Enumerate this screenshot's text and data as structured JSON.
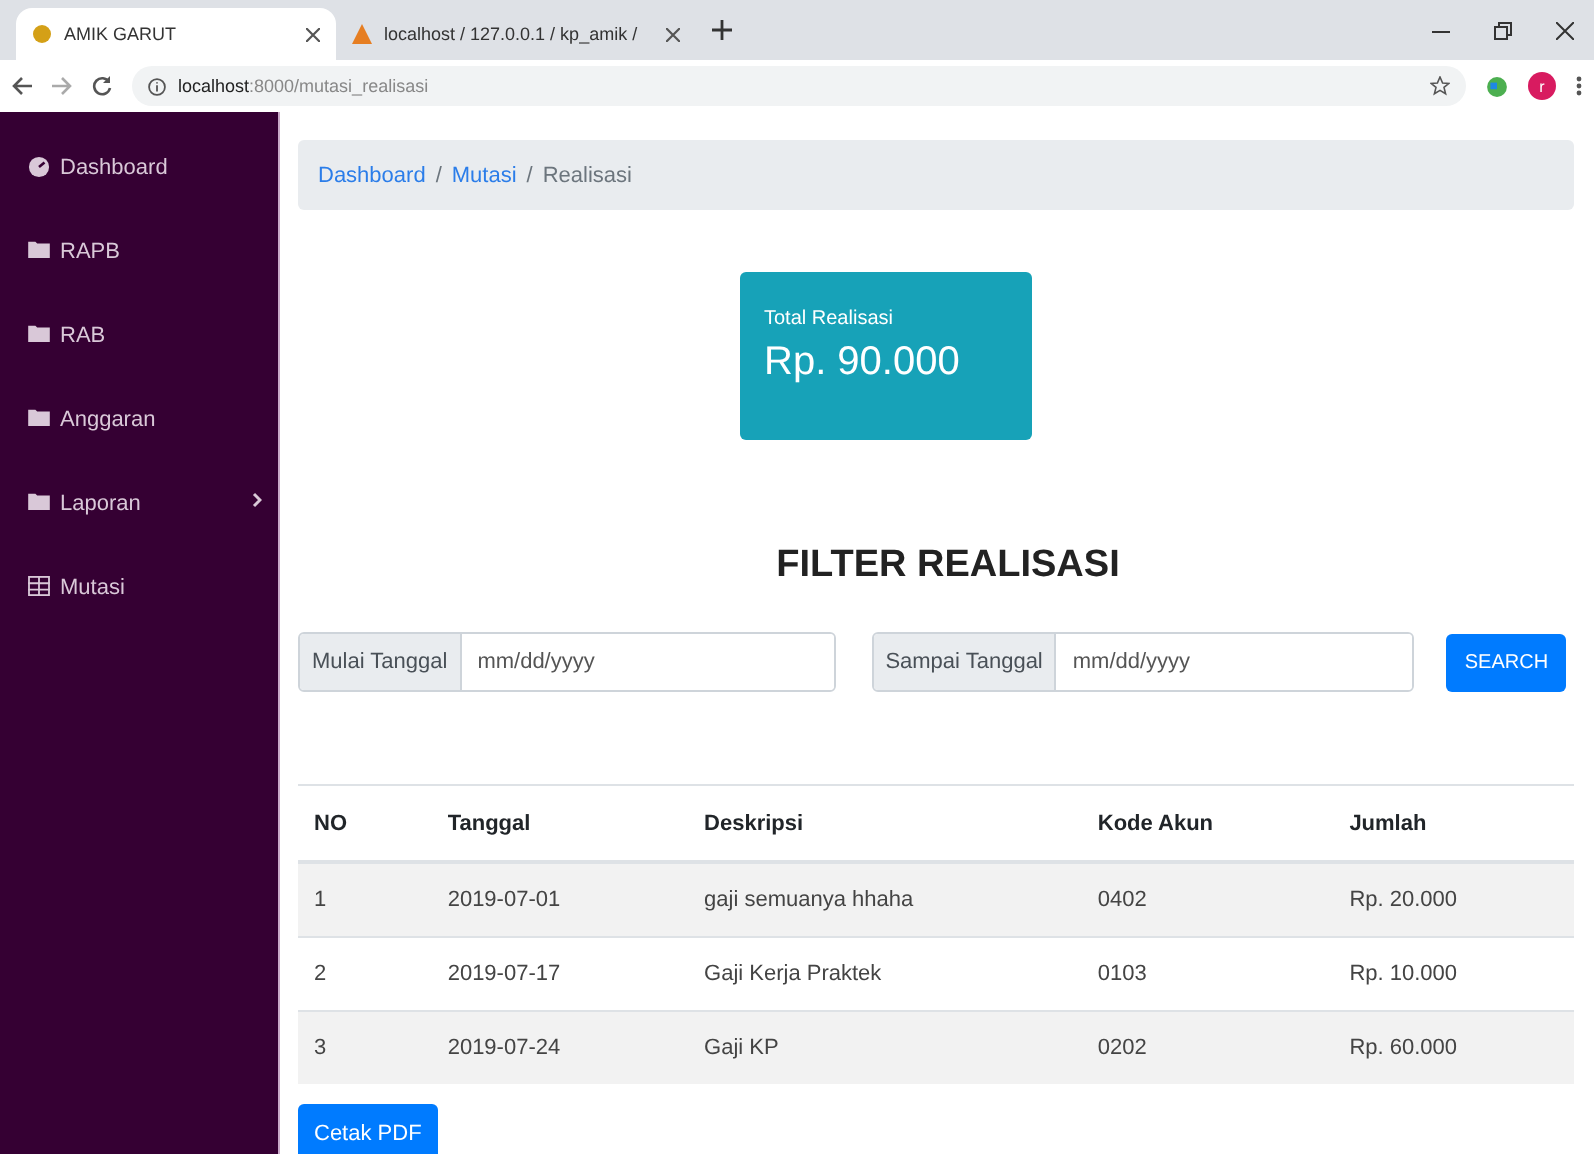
{
  "browser": {
    "tabs": [
      {
        "title": "AMIK GARUT",
        "selected": true
      },
      {
        "title": "localhost / 127.0.0.1 / kp_amik /",
        "selected": false
      }
    ],
    "address": {
      "host": "localhost",
      "path": ":8000/mutasi_realisasi"
    },
    "avatar": "r"
  },
  "sidebar": {
    "items": [
      {
        "label": "Dashboard",
        "kind": "dashboard",
        "has_submenu": false
      },
      {
        "label": "RAPB",
        "kind": "folder",
        "has_submenu": false
      },
      {
        "label": "RAB",
        "kind": "folder",
        "has_submenu": false
      },
      {
        "label": "Anggaran",
        "kind": "folder",
        "has_submenu": false
      },
      {
        "label": "Laporan",
        "kind": "folder",
        "has_submenu": true
      },
      {
        "label": "Mutasi",
        "kind": "table",
        "has_submenu": false
      }
    ]
  },
  "breadcrumb_separator": "/",
  "breadcrumb": [
    {
      "label": "Dashboard",
      "link": true
    },
    {
      "label": "Mutasi",
      "link": true
    },
    {
      "label": "Realisasi",
      "link": false
    }
  ],
  "total_card": {
    "label": "Total Realisasi",
    "value": "Rp. 90.000"
  },
  "filter": {
    "title": "FILTER REALISASI",
    "start": {
      "label": "Mulai Tanggal",
      "placeholder": "mm/dd/yyyy"
    },
    "end": {
      "label": "Sampai Tanggal",
      "placeholder": "mm/dd/yyyy"
    },
    "button": "SEARCH"
  },
  "table": {
    "columns": [
      "NO",
      "Tanggal",
      "Deskripsi",
      "Kode Akun",
      "Jumlah"
    ],
    "rows": [
      [
        "1",
        "2019-07-01",
        "gaji semuanya hhaha",
        "0402",
        "Rp. 20.000"
      ],
      [
        "2",
        "2019-07-17",
        "Gaji Kerja Praktek",
        "0103",
        "Rp. 10.000"
      ],
      [
        "3",
        "2019-07-24",
        "Gaji KP",
        "0202",
        "Rp. 60.000"
      ]
    ]
  },
  "print_button": "Cetak PDF"
}
